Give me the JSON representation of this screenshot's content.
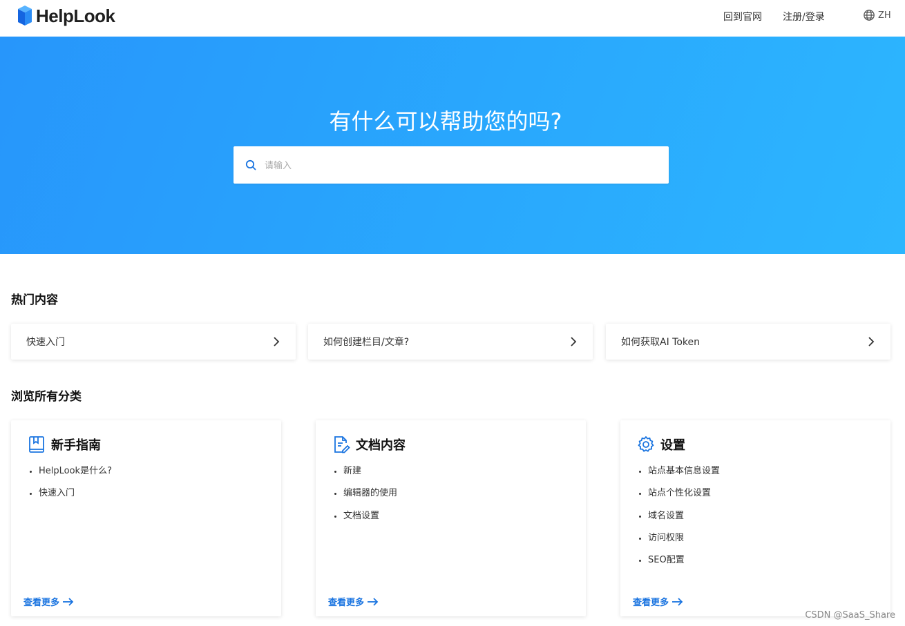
{
  "header": {
    "logo_text": "HelpLook",
    "nav": [
      "回到官网",
      "注册/登录"
    ],
    "lang": "ZH"
  },
  "hero": {
    "title": "有什么可以帮助您的吗?",
    "search_placeholder": "请输入"
  },
  "hot": {
    "title": "热门内容",
    "items": [
      {
        "label": "快速入门"
      },
      {
        "label": "如何创建栏目/文章?"
      },
      {
        "label": "如何获取AI Token"
      }
    ]
  },
  "categories": {
    "title": "浏览所有分类",
    "items": [
      {
        "title": "新手指南",
        "icon": "book-icon",
        "entries": [
          "HelpLook是什么?",
          "快速入门"
        ],
        "more": "查看更多"
      },
      {
        "title": "文档内容",
        "icon": "document-edit-icon",
        "entries": [
          "新建",
          "编辑器的使用",
          "文档设置"
        ],
        "more": "查看更多"
      },
      {
        "title": "设置",
        "icon": "gear-icon",
        "entries": [
          "站点基本信息设置",
          "站点个性化设置",
          "域名设置",
          "访问权限",
          "SEO配置"
        ],
        "more": "查看更多"
      }
    ]
  },
  "watermark": "CSDN @SaaS_Share",
  "colors": {
    "accent": "#1a74e0",
    "hero_start": "#2796fb",
    "hero_end": "#2db6fe"
  }
}
